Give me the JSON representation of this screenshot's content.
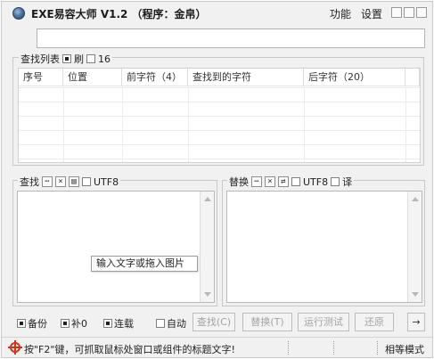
{
  "window": {
    "title": "EXE易容大师 V1.2 （程序：金帛）",
    "menu": [
      "功能",
      "设置"
    ]
  },
  "top_input": {
    "value": ""
  },
  "find_list": {
    "legend": "查找列表",
    "refresh_label": "刷",
    "count": "16",
    "columns": [
      "序号",
      "位置",
      "前字符（4）",
      "查找到的字符",
      "后字符（20）"
    ]
  },
  "find_group": {
    "legend": "查找",
    "utf8_label": "UTF8",
    "icons": [
      "dots-icon",
      "clear-icon",
      "paste-icon"
    ]
  },
  "replace_group": {
    "legend": "替换",
    "utf8_label": "UTF8",
    "translate_label": "译",
    "icons": [
      "dots-icon",
      "clear-icon",
      "swap-icon"
    ]
  },
  "tooltip": "输入文字或拖入图片",
  "options": {
    "backup": "备份",
    "fill_zero": "补0",
    "continuous": "连载",
    "auto": "自动"
  },
  "buttons": {
    "find": "查找(C)",
    "replace": "替换(T)",
    "run_test": "运行测试",
    "restore": "还原",
    "arrow": "→"
  },
  "status": {
    "hint": "按\"F2\"键，可抓取鼠标处窗口或组件的标题文字!",
    "mode": "相等模式"
  }
}
